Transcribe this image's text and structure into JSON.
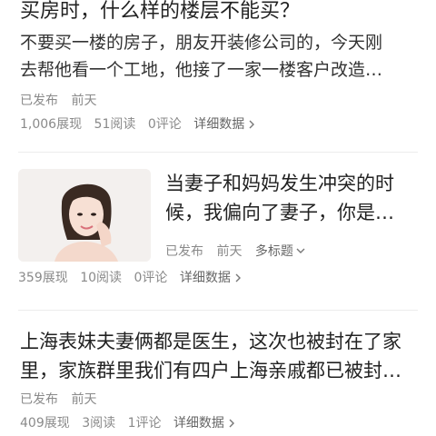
{
  "articles": [
    {
      "title": "买房时，什么样的楼层不能买？",
      "summary_lines": [
        "不要买一楼的房子，朋友开装修公司的，今天刚",
        "去帮他看一个工地，他接了一家一楼客户改造…"
      ],
      "status": "已发布",
      "date": "前天",
      "views": "1,006展现",
      "reads": "51阅读",
      "comments": "0评论",
      "details": "详细数据"
    },
    {
      "title_lines": [
        "当妻子和妈妈发生冲突的时",
        "候，我偏向了妻子，你是…"
      ],
      "status": "已发布",
      "date": "前天",
      "multi_title": "多标题",
      "views": "359展现",
      "reads": "10阅读",
      "comments": "0评论",
      "details": "详细数据"
    },
    {
      "title_lines": [
        "上海表妹夫妻俩都是医生，这次也被封在了家",
        "里，家族群里我们有四户上海亲戚都已被封…"
      ],
      "status": "已发布",
      "date": "前天",
      "views": "409展现",
      "reads": "3阅读",
      "comments": "1评论",
      "details": "详细数据"
    }
  ],
  "icons": {
    "details_arrow": "chevron-right-icon",
    "multi_title_arrow": "chevron-down-icon"
  }
}
